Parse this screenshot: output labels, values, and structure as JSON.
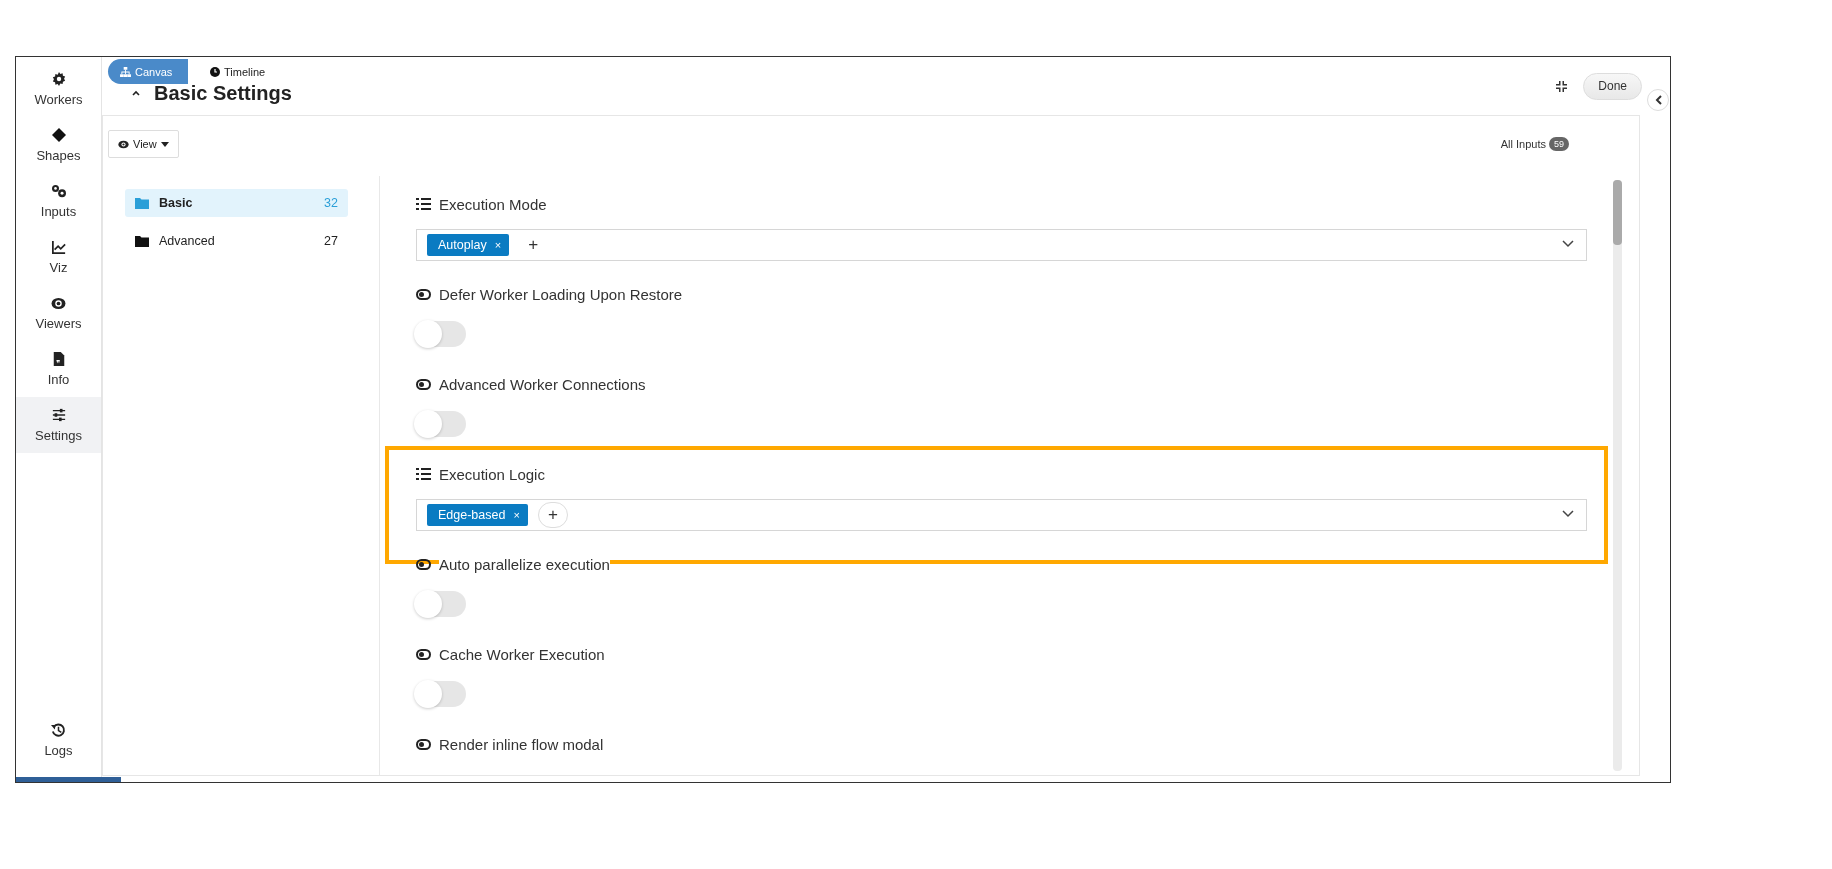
{
  "sidebar": {
    "items": [
      {
        "label": "Workers",
        "selected": false
      },
      {
        "label": "Shapes",
        "selected": false
      },
      {
        "label": "Inputs",
        "selected": false
      },
      {
        "label": "Viz",
        "selected": false
      },
      {
        "label": "Viewers",
        "selected": false
      },
      {
        "label": "Info",
        "selected": false
      },
      {
        "label": "Settings",
        "selected": true
      }
    ],
    "bottom_item": {
      "label": "Logs",
      "selected": false
    }
  },
  "tabs": [
    {
      "label": "Canvas",
      "selected": true
    },
    {
      "label": "Timeline",
      "selected": false
    }
  ],
  "header": {
    "title": "Basic Settings",
    "done_button": "Done"
  },
  "toolbar": {
    "view_button": "View",
    "all_inputs": {
      "label": "All Inputs",
      "count": "59"
    }
  },
  "folders": [
    {
      "label": "Basic",
      "count": "32",
      "selected": true
    },
    {
      "label": "Advanced",
      "count": "27",
      "selected": false
    }
  ],
  "settings": [
    {
      "kind": "select",
      "label": "Execution Mode",
      "tags": [
        {
          "label": "Autoplay",
          "remove": "×"
        }
      ],
      "add": {
        "label": "+",
        "focused": false
      },
      "highlighted": false
    },
    {
      "kind": "toggle",
      "label": "Defer Worker Loading Upon Restore",
      "on": false,
      "highlighted": false
    },
    {
      "kind": "toggle",
      "label": "Advanced Worker Connections",
      "on": false,
      "highlighted": false
    },
    {
      "kind": "select",
      "label": "Execution Logic",
      "tags": [
        {
          "label": "Edge-based",
          "remove": "×"
        }
      ],
      "add": {
        "label": "+",
        "focused": true
      },
      "highlighted": true
    },
    {
      "kind": "toggle",
      "label": "Auto parallelize execution",
      "on": false,
      "highlighted": false
    },
    {
      "kind": "toggle",
      "label": "Cache Worker Execution",
      "on": false,
      "highlighted": false
    },
    {
      "kind": "toggle",
      "label": "Render inline flow modal",
      "highlighted": false
    }
  ]
}
